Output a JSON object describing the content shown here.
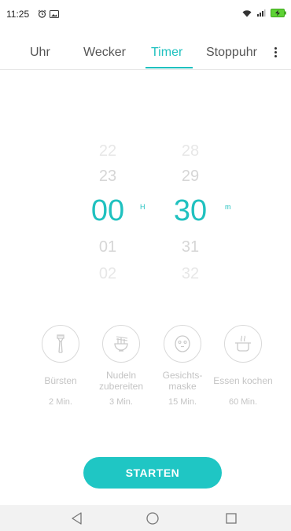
{
  "status": {
    "time": "11:25"
  },
  "tabs": [
    {
      "label": "Uhr",
      "active": false
    },
    {
      "label": "Wecker",
      "active": false
    },
    {
      "label": "Timer",
      "active": true
    },
    {
      "label": "Stoppuhr",
      "active": false
    }
  ],
  "picker": {
    "hours": {
      "above2": "22",
      "above1": "23",
      "selected": "00",
      "below1": "01",
      "below2": "02",
      "unit": "H"
    },
    "minutes": {
      "above2": "28",
      "above1": "29",
      "selected": "30",
      "below1": "31",
      "below2": "32",
      "unit": "m"
    }
  },
  "presets": [
    {
      "icon": "toothbrush-icon",
      "label": "Bürsten",
      "duration": "2 Min."
    },
    {
      "icon": "noodles-icon",
      "label": "Nudeln zubereiten",
      "duration": "3 Min."
    },
    {
      "icon": "face-mask-icon",
      "label": "Gesichts-maske",
      "duration": "15 Min."
    },
    {
      "icon": "cooking-pot-icon",
      "label": "Essen kochen",
      "duration": "60 Min."
    }
  ],
  "start_button": {
    "label": "STARTEN"
  },
  "colors": {
    "accent": "#1fc1bf",
    "faint_text": "#c4c4c4"
  }
}
